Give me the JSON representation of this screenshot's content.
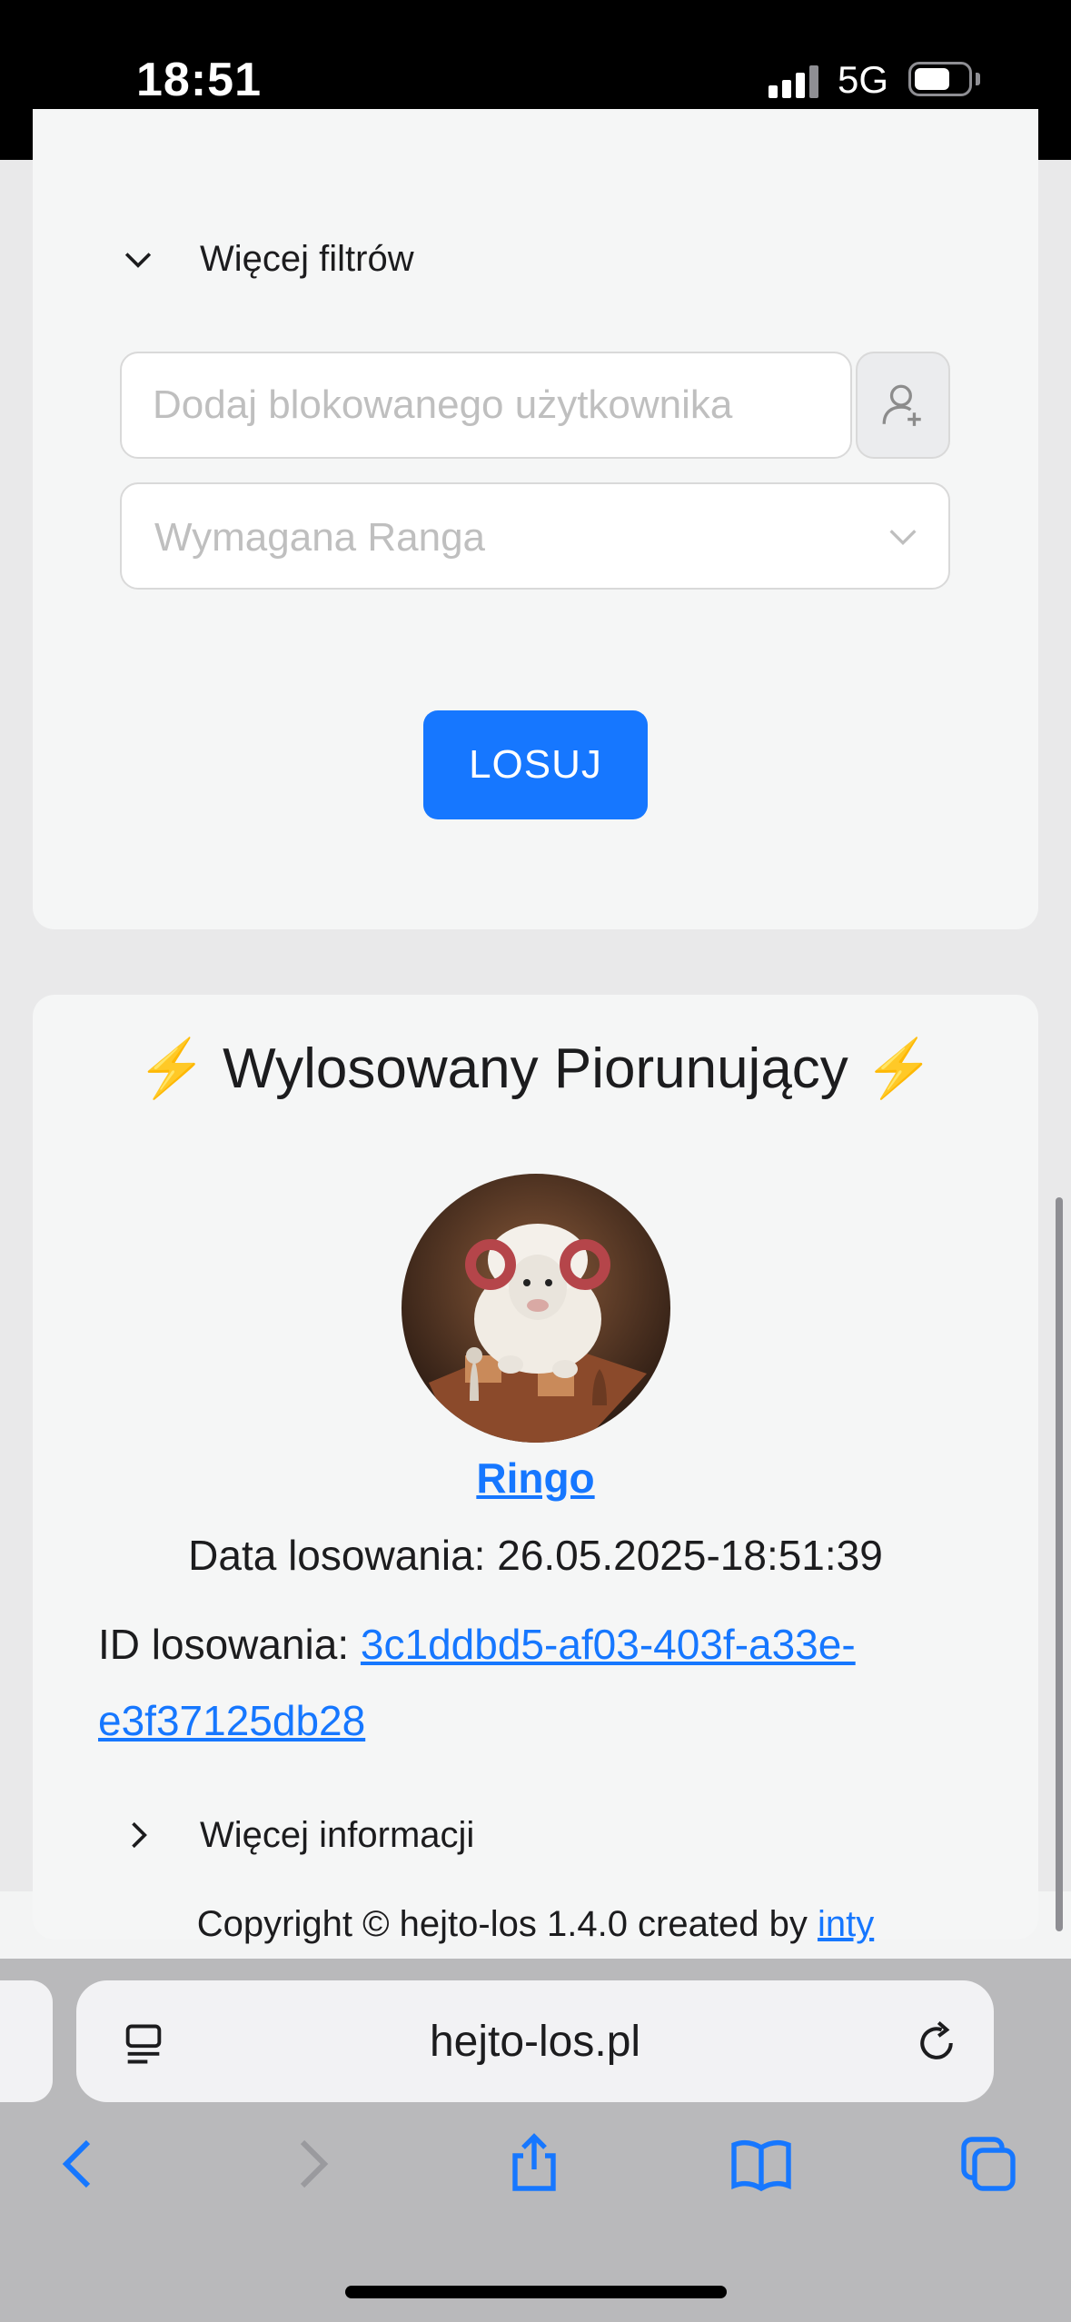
{
  "status_bar": {
    "time": "18:51",
    "network": "5G"
  },
  "filters": {
    "more_filters_label": "Więcej filtrów",
    "blocked_user_placeholder": "Dodaj blokowanego użytkownika",
    "rank_placeholder": "Wymagana Ranga",
    "draw_button": "LOSUJ"
  },
  "result": {
    "title": "Wylosowany Piorunujący",
    "title_emoji": "⚡",
    "winner_name": "Ringo",
    "date_label": "Data losowania:",
    "date_value": "26.05.2025-18:51:39",
    "id_label": "ID losowania:",
    "id_value": "3c1ddbd5-af03-403f-a33e-e3f37125db28",
    "more_info_label": "Więcej informacji"
  },
  "footer": {
    "copyright_text": "Copyright © hejto-los 1.4.0 created by",
    "author_link": "inty"
  },
  "browser": {
    "url": "hejto-los.pl"
  },
  "colors": {
    "accent": "#1677ff",
    "bolt": "#f5b800",
    "card_bg": "#f5f6f6",
    "page_bg": "#e9e9ea"
  }
}
